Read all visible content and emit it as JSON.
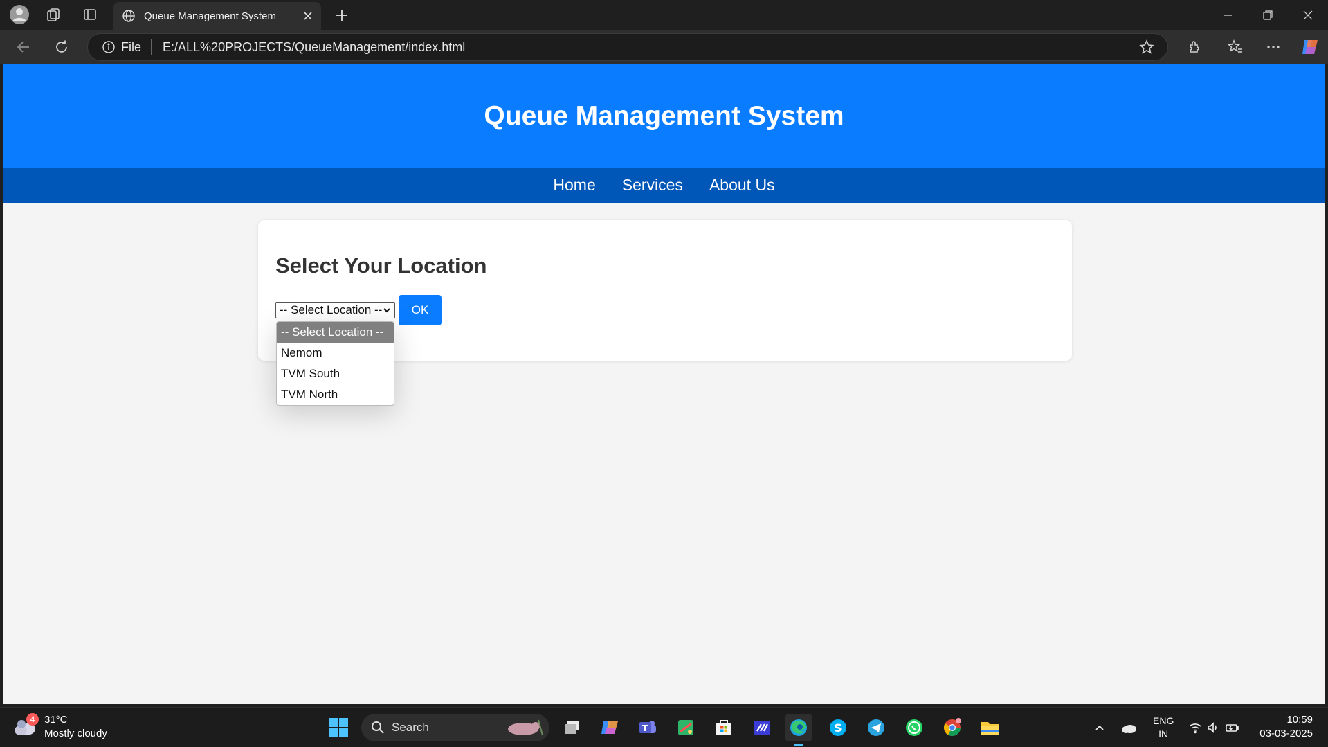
{
  "browser": {
    "tab_title": "Queue Management System",
    "address_label": "File",
    "url": "E:/ALL%20PROJECTS/QueueManagement/index.html"
  },
  "page": {
    "header_title": "Queue Management System",
    "nav": [
      "Home",
      "Services",
      "About Us"
    ],
    "section_title": "Select Your Location",
    "select_value": "-- Select Location --",
    "ok_label": "OK",
    "options": [
      "-- Select Location --",
      "Nemom",
      "TVM South",
      "TVM North"
    ],
    "accent_color": "#0a7cff",
    "nav_color": "#0057b8"
  },
  "taskbar": {
    "weather_badge": "4",
    "temperature": "31°C",
    "weather_desc": "Mostly cloudy",
    "search_label": "Search",
    "lang_line1": "ENG",
    "lang_line2": "IN",
    "time": "10:59",
    "date": "03-03-2025"
  }
}
